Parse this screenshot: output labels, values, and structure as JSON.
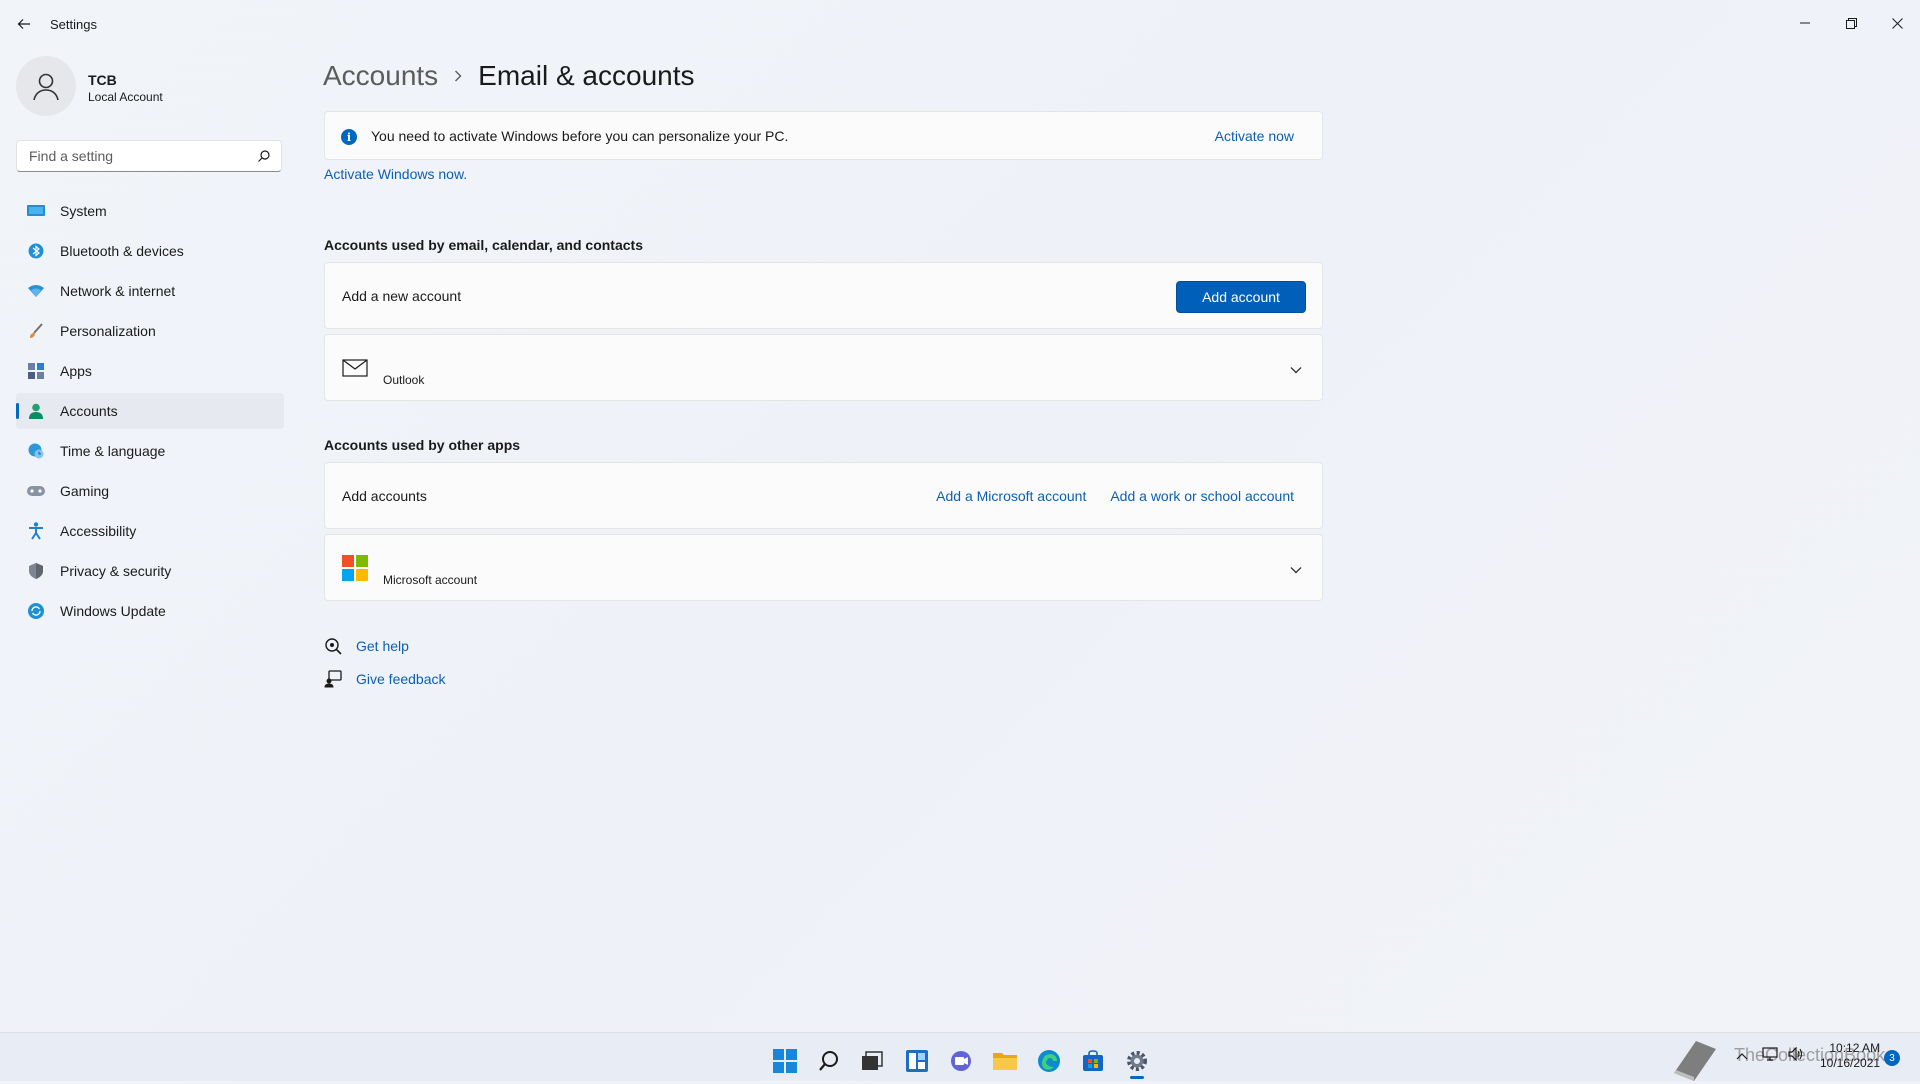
{
  "window": {
    "title": "Settings"
  },
  "profile": {
    "name": "TCB",
    "account_type": "Local Account"
  },
  "search": {
    "placeholder": "Find a setting"
  },
  "sidebar": {
    "items": [
      {
        "label": "System",
        "icon": "system-icon"
      },
      {
        "label": "Bluetooth & devices",
        "icon": "bluetooth-icon"
      },
      {
        "label": "Network & internet",
        "icon": "wifi-icon"
      },
      {
        "label": "Personalization",
        "icon": "brush-icon"
      },
      {
        "label": "Apps",
        "icon": "apps-icon"
      },
      {
        "label": "Accounts",
        "icon": "person-icon",
        "active": true
      },
      {
        "label": "Time & language",
        "icon": "globe-clock-icon"
      },
      {
        "label": "Gaming",
        "icon": "gamepad-icon"
      },
      {
        "label": "Accessibility",
        "icon": "accessibility-icon"
      },
      {
        "label": "Privacy & security",
        "icon": "shield-icon"
      },
      {
        "label": "Windows Update",
        "icon": "update-icon"
      }
    ]
  },
  "breadcrumb": {
    "parent": "Accounts",
    "current": "Email & accounts"
  },
  "activation_banner": {
    "message": "You need to activate Windows before you can personalize your PC.",
    "action": "Activate now",
    "link": "Activate Windows now."
  },
  "email_section": {
    "title": "Accounts used by email, calendar, and contacts",
    "add_row_label": "Add a new account",
    "add_button": "Add account",
    "account_name": "Outlook"
  },
  "other_section": {
    "title": "Accounts used by other apps",
    "add_row_label": "Add accounts",
    "add_microsoft": "Add a Microsoft account",
    "add_work": "Add a work or school account",
    "account_name": "Microsoft account"
  },
  "help_links": {
    "get_help": "Get help",
    "give_feedback": "Give feedback"
  },
  "taskbar": {
    "time": "10:12 AM",
    "date": "10/16/2021",
    "notification_count": "3",
    "watermark": "TheCollectionBook"
  },
  "colors": {
    "accent": "#005fb8",
    "link": "#0a5fb5",
    "background": "#f1f4f9"
  }
}
